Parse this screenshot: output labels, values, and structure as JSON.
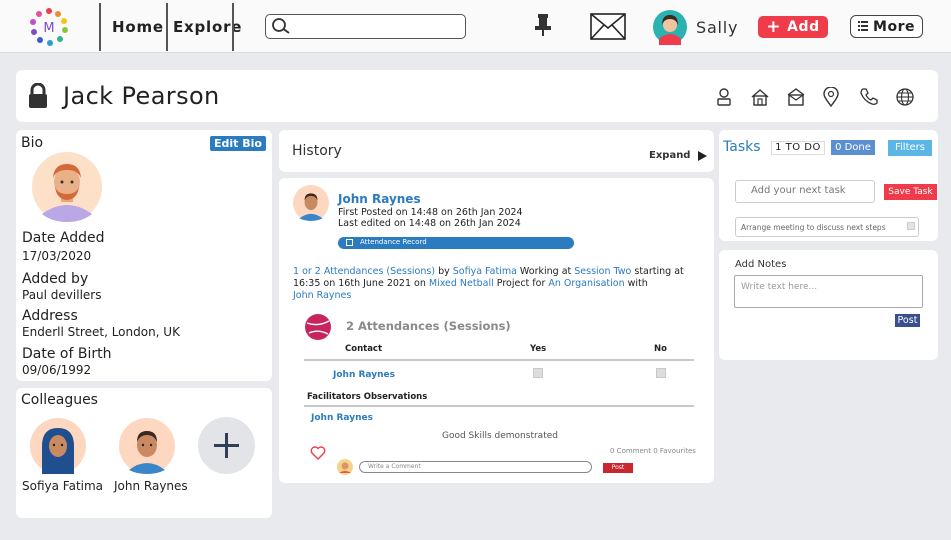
{
  "nav": {
    "home": "Home",
    "explore": "Explore",
    "user_name": "Sally",
    "add_label": "Add",
    "more_label": "More"
  },
  "profile": {
    "name": "Jack Pearson"
  },
  "bio": {
    "title": "Bio",
    "edit_label": "Edit Bio",
    "date_added_label": "Date Added",
    "date_added": "17/03/2020",
    "added_by_label": "Added by",
    "added_by": "Paul devillers",
    "address_label": "Address",
    "address": "Enderll Street, London, UK",
    "dob_label": "Date of Birth",
    "dob": "09/06/1992"
  },
  "colleagues": {
    "title": "Colleagues",
    "items": [
      {
        "name": "Sofiya Fatima"
      },
      {
        "name": "John Raynes"
      }
    ]
  },
  "history": {
    "title": "History",
    "expand_label": "Expand",
    "entry": {
      "author": "John Raynes",
      "first_posted": "First Posted on 14:48 on 26th Jan 2024",
      "last_edited": "Last edited on 14:48 on 26th Jan 2024",
      "record_type": "Attendance Record",
      "desc": {
        "attendances": "1 or 2 Attendances (Sessions)",
        "by": " by ",
        "person": "Sofiya Fatima",
        "working_at": " Working at ",
        "session": "Session Two",
        "starting_at": " starting at 16:35 on 16th June 2021 on ",
        "project": "Mixed Netball",
        "project_for": " Project for ",
        "org": "An Organisation",
        "with": " with",
        "with_person": "John Raynes"
      },
      "attendance_title": "2 Attendances (Sessions)",
      "table": {
        "col_contact": "Contact",
        "col_yes": "Yes",
        "col_no": "No",
        "rows": [
          {
            "contact": "John Raynes",
            "yes": true,
            "no": false
          }
        ]
      },
      "observations_title": "Facilitators Observations",
      "observer": "John Raynes",
      "observation": "Good Skills demonstrated",
      "counts": "0 Comment 0 Favourites",
      "comment_placeholder": "Write a Comment",
      "post_label": "Post"
    }
  },
  "tasks": {
    "title": "Tasks",
    "todo_label": "1 TO DO",
    "done_label": "0 Done",
    "filters_label": "Filters",
    "input_placeholder": "Add your next task",
    "save_label": "Save Task",
    "items": [
      {
        "text": "Arrange meeting to discuss next steps",
        "done": false
      }
    ]
  },
  "notes": {
    "title": "Add Notes",
    "placeholder": "Write text here...",
    "post_label": "Post"
  },
  "colors": {
    "accent_blue": "#2a7bc0",
    "add_red": "#ef3b4a",
    "record_blue": "#2a7bc0",
    "filters_blue": "#5bb6e6"
  }
}
